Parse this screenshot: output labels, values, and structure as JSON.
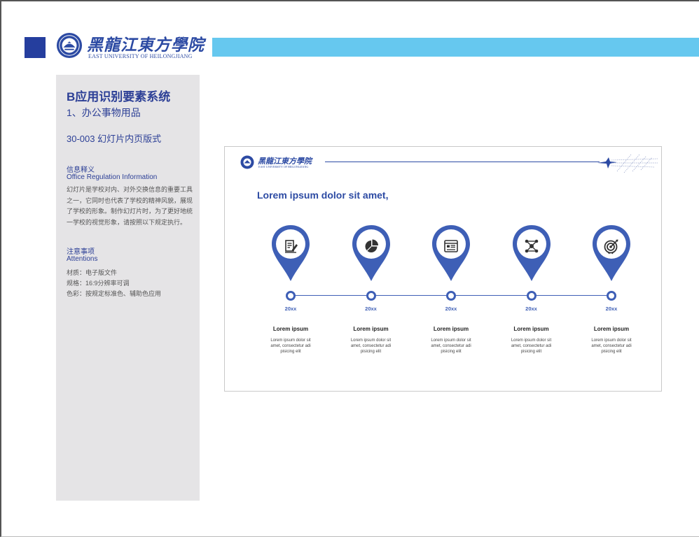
{
  "header": {
    "logo_cn": "黑龍江東方學院",
    "logo_en": "EAST UNIVERSITY OF HEILONGJIANG"
  },
  "sidebar": {
    "title": "B应用识别要素系统",
    "subtitle": "1、办公事物用品",
    "code": "30-003 幻灯片内页版式",
    "info_heading_cn": "信息释义",
    "info_heading_en": "Office Regulation Information",
    "info_body": "幻灯片是学校对内、对外交换信息的重要工具之一，它同时也代表了学校的精神风貌，展现了学校的形象。制作幻灯片时，为了更好地统一学校的视觉形象，请按照以下规定执行。",
    "notes_heading_cn": "注意事项",
    "notes_heading_en": "Attentions",
    "notes": [
      "材质：电子版文件",
      "规格：16:9分辨率可调",
      "色彩：按规定标准色、辅助色应用"
    ]
  },
  "slide": {
    "logo_cn": "黑龍江東方學院",
    "logo_en": "EAST UNIVERSITY OF HEILONGJIANG",
    "heading": "Lorem ipsum dolor sit amet,",
    "steps": [
      {
        "icon": "document-edit-icon",
        "year": "20xx",
        "title": "Lorem ipsum",
        "desc": "Lorem ipsum dolor sit amet, consectetur adipisicing elit"
      },
      {
        "icon": "pie-chart-icon",
        "year": "20xx",
        "title": "Lorem ipsum",
        "desc": "Lorem ipsum dolor sit amet, consectetur adipisicing elit"
      },
      {
        "icon": "browser-window-icon",
        "year": "20xx",
        "title": "Lorem ipsum",
        "desc": "Lorem ipsum dolor sit amet, consectetur adipisicing elit"
      },
      {
        "icon": "network-icon",
        "year": "20xx",
        "title": "Lorem ipsum",
        "desc": "Lorem ipsum dolor sit amet, consectetur adipisicing elit"
      },
      {
        "icon": "target-icon",
        "year": "20xx",
        "title": "Lorem ipsum",
        "desc": "Lorem ipsum dolor sit amet, consectetur adipisicing elit"
      }
    ]
  },
  "colors": {
    "primary": "#2c4aa3",
    "accent_band": "#66c8ef",
    "panel_bg": "#e5e4e6",
    "corner_square": "#253e9e"
  }
}
